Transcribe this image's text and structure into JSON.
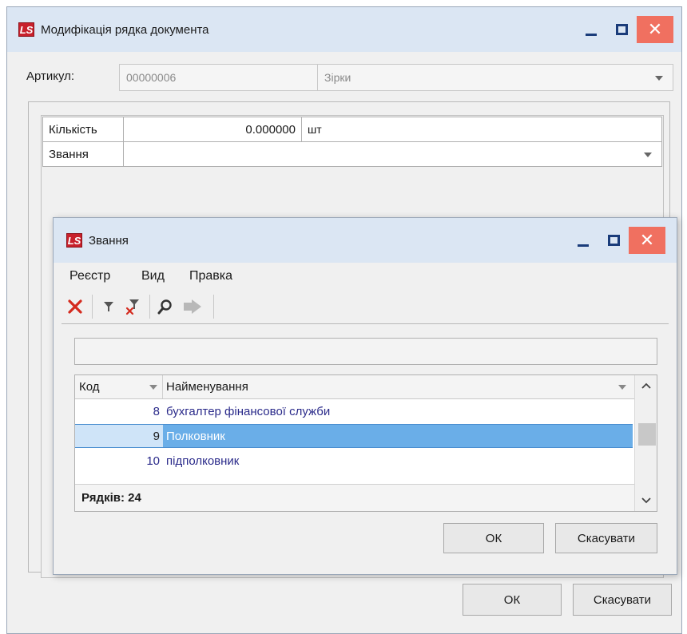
{
  "main_window": {
    "title": "Модифікація рядка документа",
    "article_label": "Артикул:",
    "article_code": "00000006",
    "article_name": "Зірки",
    "fields": [
      {
        "label": "Кількість",
        "value": "0.000000",
        "unit": "шт"
      },
      {
        "label": "Звання",
        "value": ""
      }
    ],
    "ok_label": "ОК",
    "cancel_label": "Скасувати"
  },
  "dialog": {
    "title": "Звання",
    "menu": [
      "Реєстр",
      "Вид",
      "Правка"
    ],
    "toolbar_icons": [
      "delete-icon",
      "filter-icon",
      "clear-filter-icon",
      "search-icon",
      "navigate-icon"
    ],
    "search_value": "",
    "table": {
      "columns": [
        "Код",
        "Найменування"
      ],
      "rows": [
        {
          "code": "8",
          "name": "бухгалтер фінансової служби"
        },
        {
          "code": "9",
          "name": "Полковник"
        },
        {
          "code": "10",
          "name": "підполковник"
        }
      ],
      "selected_index": 1,
      "footer": "Рядків: 24"
    },
    "ok_label": "ОК",
    "cancel_label": "Скасувати"
  },
  "colors": {
    "titlebar": "#dbe6f3",
    "close_button": "#f07060",
    "selection": "#6aaee8",
    "logo": "#c8202b",
    "row_text": "#2a2a8a"
  }
}
